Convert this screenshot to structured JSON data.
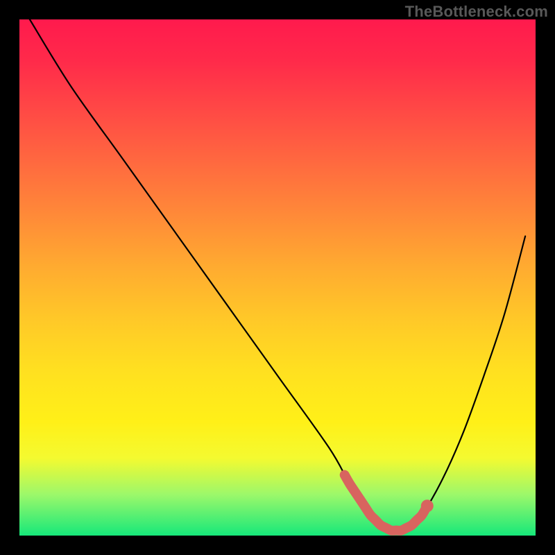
{
  "watermark": "TheBottleneck.com",
  "chart_data": {
    "type": "line",
    "title": "",
    "xlabel": "",
    "ylabel": "",
    "xlim": [
      0,
      100
    ],
    "ylim": [
      0,
      100
    ],
    "grid": false,
    "legend": false,
    "series": [
      {
        "name": "bottleneck-curve",
        "x": [
          2,
          10,
          20,
          30,
          40,
          50,
          60,
          64,
          68,
          70,
          72,
          74,
          76,
          78,
          82,
          86,
          90,
          94,
          98
        ],
        "y": [
          100,
          87,
          73,
          59,
          45,
          31,
          17,
          10,
          4,
          2,
          1,
          1,
          2,
          4,
          11,
          20,
          31,
          43,
          58
        ]
      }
    ],
    "annotations": {
      "sweet_spot_range_x": [
        63,
        79
      ],
      "sweet_spot_end_x": 79,
      "background_gradient_stops": [
        {
          "pos": 0.0,
          "color": "#ff1a4d"
        },
        {
          "pos": 0.5,
          "color": "#ffc828"
        },
        {
          "pos": 0.85,
          "color": "#f4fa30"
        },
        {
          "pos": 1.0,
          "color": "#16e87a"
        }
      ]
    }
  }
}
